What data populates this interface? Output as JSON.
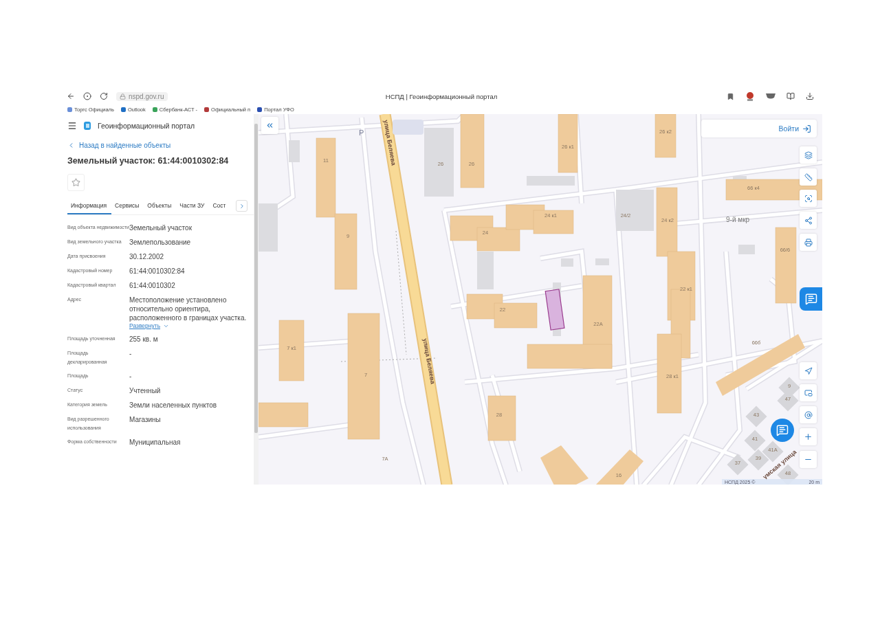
{
  "browser": {
    "url": "nspd.gov.ru",
    "title": "НСПД | Геоинформационный портал",
    "bookmarks": [
      {
        "label": "Торгс Официаль",
        "color": "#6a8fd8"
      },
      {
        "label": "Outlook",
        "color": "#1f6fc4"
      },
      {
        "label": "Сбербанк-АСТ -",
        "color": "#3aa35a"
      },
      {
        "label": "Официальный п",
        "color": "#b23a3a"
      },
      {
        "label": "Портал УФО",
        "color": "#2a4fb0"
      }
    ]
  },
  "sidebar": {
    "app_title": "Геоинформационный портал",
    "back_link": "Назад в найденные объекты",
    "heading": "Земельный участок: 61:44:0010302:84",
    "favorite": false,
    "tabs": [
      {
        "label": "Информация",
        "selected": true
      },
      {
        "label": "Сервисы",
        "selected": false
      },
      {
        "label": "Объекты",
        "selected": false
      },
      {
        "label": "Части ЗУ",
        "selected": false
      },
      {
        "label": "Сост",
        "selected": false
      }
    ],
    "fields": [
      {
        "label": "Вид объекта недвижимости",
        "value": "Земельный участок"
      },
      {
        "label": "Вид земельного участка",
        "value": "Землепользование"
      },
      {
        "label": "Дата присвоения",
        "value": "30.12.2002"
      },
      {
        "label": "Кадастровый номер",
        "value": "61:44:0010302:84"
      },
      {
        "label": "Кадастровый квартал",
        "value": "61:44:0010302"
      },
      {
        "label": "Адрес",
        "value": "Местоположение установлено относительно ориентира, расположенного в границах участка.",
        "link": "Развернуть"
      },
      {
        "label": "Площадь уточненная",
        "value": "255 кв. м"
      },
      {
        "label": "Площадь декларированная",
        "value": "-"
      },
      {
        "label": "Площадь",
        "value": "-"
      },
      {
        "label": "Статус",
        "value": "Учтенный"
      },
      {
        "label": "Категория земель",
        "value": "Земли населенных пунктов"
      },
      {
        "label": "Вид разрешенного использования",
        "value": "Магазины"
      },
      {
        "label": "Форма собственности",
        "value": "Муниципальная"
      }
    ]
  },
  "map": {
    "login": "Войти",
    "parking": "P",
    "street_labels": [
      "улица Беляева",
      "улица Беляева",
      "умская улица"
    ],
    "area_label": "9-й мкр",
    "building_labels": [
      "11",
      "9",
      "26",
      "26",
      "26 к1",
      "26 к2",
      "24",
      "24 к1",
      "24/2",
      "24 к2",
      "22",
      "22А",
      "22 к1",
      "7 к1",
      "7",
      "7А",
      "28",
      "28 к1",
      "16",
      "66 к4",
      "66/6",
      "66б",
      "43",
      "41",
      "41А",
      "39",
      "37",
      "9",
      "47",
      "48"
    ],
    "attribution": "НСПД 2025 ©",
    "scale": "20 m"
  }
}
